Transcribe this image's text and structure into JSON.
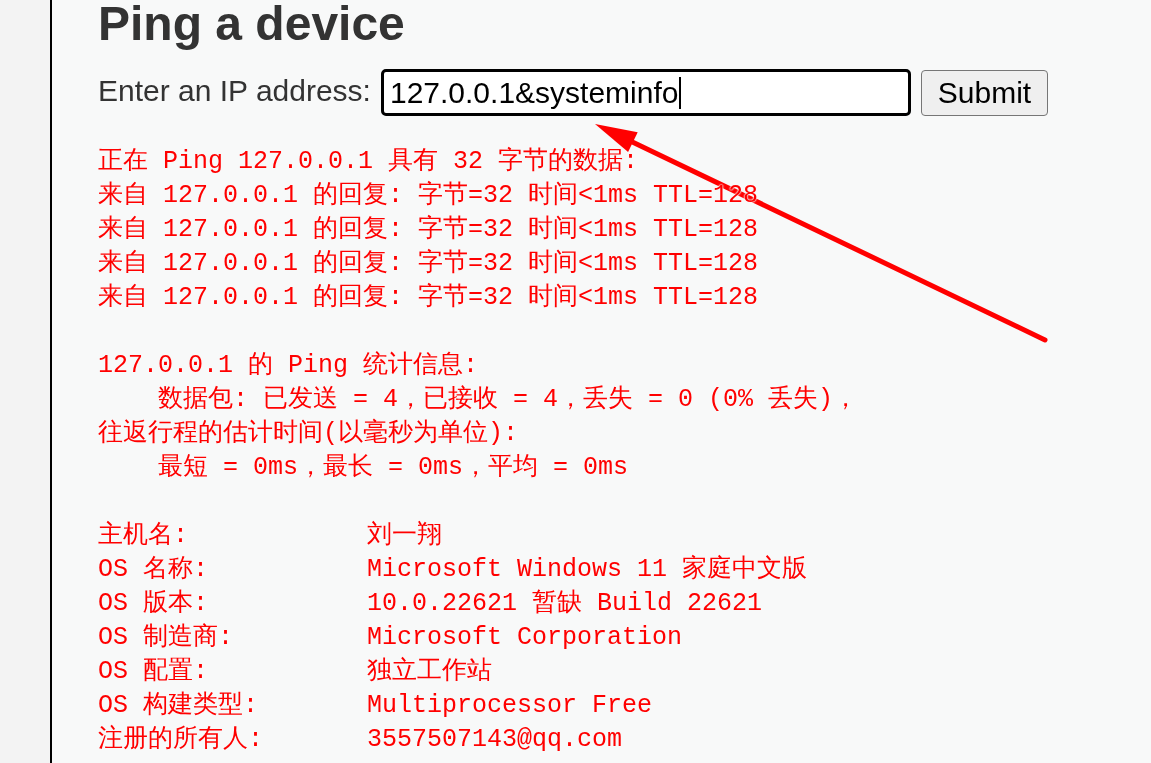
{
  "page_title": "Ping a device",
  "form": {
    "label": "Enter an IP address:",
    "input": {
      "value": "127.0.0.1&systeminfo",
      "focused": true
    },
    "submit_button": "Submit"
  },
  "output": {
    "ping_lines": [
      "正在 Ping 127.0.0.1 具有 32 字节的数据:",
      "来自 127.0.0.1 的回复: 字节=32 时间<1ms TTL=128",
      "来自 127.0.0.1 的回复: 字节=32 时间<1ms TTL=128",
      "来自 127.0.0.1 的回复: 字节=32 时间<1ms TTL=128",
      "来自 127.0.0.1 的回复: 字节=32 时间<1ms TTL=128"
    ],
    "statistics": [
      {
        "text": "127.0.0.1 的 Ping 统计信息:",
        "children": [
          {
            "text": "数据包: 已发送 = 4，已接收 = 4，丢失 = 0 (0% 丢失)，"
          }
        ]
      },
      {
        "text": "往返行程的估计时间(以毫秒为单位):",
        "children": [
          {
            "text": "最短 = 0ms，最长 = 0ms，平均 = 0ms"
          }
        ]
      }
    ],
    "system_info": [
      {
        "label": "主机名:",
        "value": "刘一翔"
      },
      {
        "label": "OS 名称:",
        "value": "Microsoft Windows 11 家庭中文版"
      },
      {
        "label": "OS 版本:",
        "value": "10.0.22621 暂缺 Build 22621"
      },
      {
        "label": "OS 制造商:",
        "value": "Microsoft Corporation"
      },
      {
        "label": "OS 配置:",
        "value": "独立工作站"
      },
      {
        "label": "OS 构建类型:",
        "value": "Multiprocessor Free"
      },
      {
        "label": "注册的所有人:",
        "value": "3557507143@qq.com"
      }
    ]
  }
}
